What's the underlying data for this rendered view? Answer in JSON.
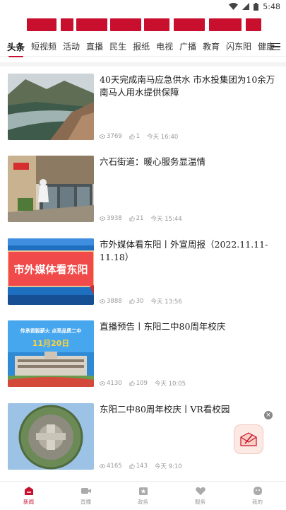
{
  "status_bar": {
    "time": "5:48"
  },
  "tabs": [
    {
      "label": "头条"
    },
    {
      "label": "短视频"
    },
    {
      "label": "活动"
    },
    {
      "label": "直播"
    },
    {
      "label": "民生"
    },
    {
      "label": "报纸"
    },
    {
      "label": "电视"
    },
    {
      "label": "广播"
    },
    {
      "label": "教育"
    },
    {
      "label": "闪东阳"
    },
    {
      "label": "健康"
    }
  ],
  "news": [
    {
      "title": "40天完成南马应急供水 市水投集团为10余万南马人用水提供保障",
      "views": "3769",
      "likes": "1",
      "time": "今天 16:40"
    },
    {
      "title": "六石街道：暖心服务显温情",
      "views": "3938",
      "likes": "21",
      "time": "今天 15:44"
    },
    {
      "title": "市外媒体看东阳丨外宣周报（2022.11.11-11.18）",
      "views": "3888",
      "likes": "30",
      "time": "今天 13:56",
      "thumb_text": "市外媒体看东阳"
    },
    {
      "title": "直播预告丨东阳二中80周年校庆",
      "views": "4130",
      "likes": "109",
      "time": "今天 10:05",
      "thumb_text_top": "传承君毅薪火  点亮品质二中",
      "thumb_text_date": "11月20日"
    },
    {
      "title": "东阳二中80周年校庆丨VR看校园",
      "views": "4165",
      "likes": "143",
      "time": "今天 9:10"
    }
  ],
  "bottom_nav": [
    {
      "label": "新闻"
    },
    {
      "label": "直播"
    },
    {
      "label": "政务"
    },
    {
      "label": "服务"
    },
    {
      "label": "我的"
    }
  ],
  "colors": {
    "accent": "#c8102e",
    "nav_inactive": "#999999"
  }
}
